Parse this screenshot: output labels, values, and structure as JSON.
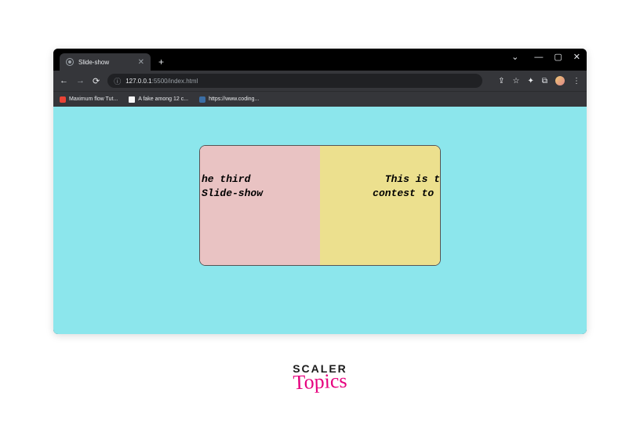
{
  "window": {
    "minimize": "—",
    "maximize": "▢",
    "close": "✕",
    "chevron": "⌄"
  },
  "tab": {
    "title": "Slide-show",
    "close": "✕",
    "new": "+"
  },
  "nav": {
    "back": "←",
    "forward": "→",
    "reload": "⟳"
  },
  "address": {
    "icon": "ⓘ",
    "host": "127.0.0.1",
    "path": ":5500/index.html"
  },
  "toolbar_icons": {
    "share": "⇪",
    "star": "☆",
    "extensions": "✦",
    "puzzle": "⧉",
    "menu": "⋮"
  },
  "bookmarks": [
    {
      "label": "Maximum flow Tut..."
    },
    {
      "label": "A fake among 12 c..."
    },
    {
      "label": "https://www.coding..."
    }
  ],
  "slides": {
    "left": "he third\nSlide-show",
    "right": "   This is t\ncontest to "
  },
  "logo": {
    "brand": "SCALER",
    "sub": "Topics"
  }
}
